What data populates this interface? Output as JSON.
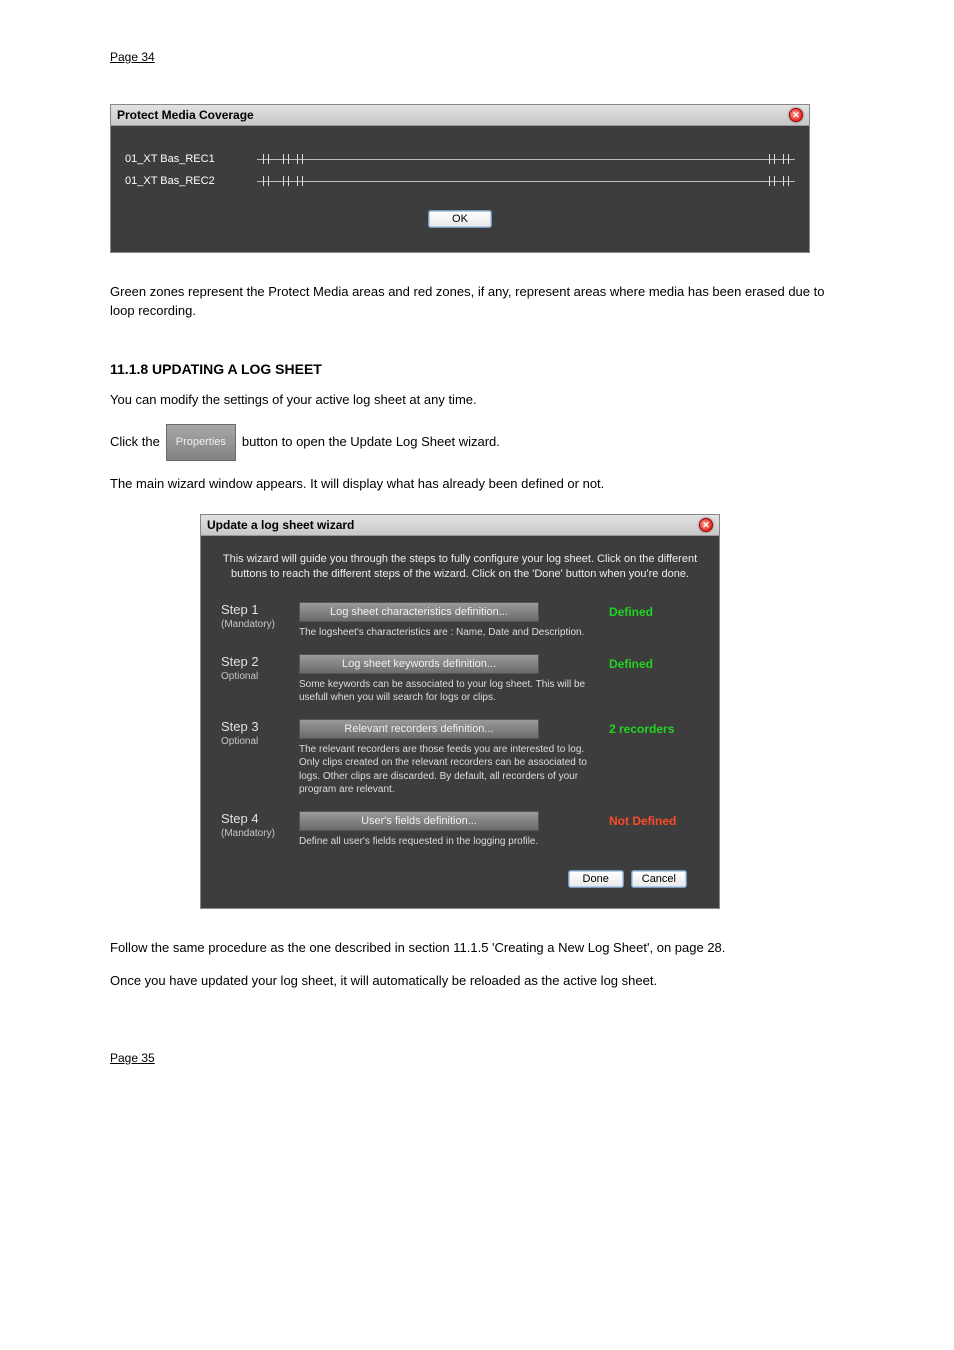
{
  "page_num_top": "Page 34",
  "page_num_bottom": "Page 35",
  "dlg1": {
    "title": "Protect Media Coverage",
    "rows": [
      "01_XT Bas_REC1",
      "01_XT Bas_REC2"
    ],
    "ok": "OK"
  },
  "para1": "Green zones represent the Protect Media areas and red zones, if any, represent areas where media has been erased due to loop recording.",
  "section_heading": "11.1.8 UPDATING A LOG SHEET",
  "para2": "You can modify the settings of your active log sheet at any time.",
  "para3_a": "Click the ",
  "prop_label": "Properties",
  "para3_b": " button to open the Update Log Sheet wizard.",
  "para4": "The main wizard window appears. It will display what has already been defined or not.",
  "dlg2": {
    "title": "Update a log sheet wizard",
    "intro": "This wizard will guide you through the steps to fully configure your  log sheet. Click on the different buttons to reach the different steps of the wizard. Click on the 'Done' button when you're done.",
    "steps": [
      {
        "name": "Step 1",
        "req": "(Mandatory)",
        "btn": "Log sheet characteristics definition...",
        "desc": "The logsheet's characteristics are : Name, Date and Description.",
        "status": "Defined",
        "status_class": "green"
      },
      {
        "name": "Step 2",
        "req": "Optional",
        "btn": "Log sheet keywords definition...",
        "desc": "Some keywords can be associated to your log sheet. This will be usefull when you will search for logs or clips.",
        "status": "Defined",
        "status_class": "green"
      },
      {
        "name": "Step 3",
        "req": "Optional",
        "btn": "Relevant recorders definition...",
        "desc": "The relevant recorders are those feeds you are interested to log. Only clips created on the relevant recorders can be associated to logs. Other clips are discarded. By default, all recorders of your program are relevant.",
        "status": "2 recorders",
        "status_class": "green"
      },
      {
        "name": "Step 4",
        "req": "(Mandatory)",
        "btn": "User's fields definition...",
        "desc": "Define all user's fields requested in the logging profile.",
        "status": "Not Defined",
        "status_class": "red"
      }
    ],
    "done": "Done",
    "cancel": "Cancel"
  },
  "after1": "Follow the same procedure as the one described in section 11.1.5 'Creating a New Log Sheet', on page 28.",
  "after2": "Once you have updated your log sheet, it will automatically be reloaded as the active log sheet."
}
